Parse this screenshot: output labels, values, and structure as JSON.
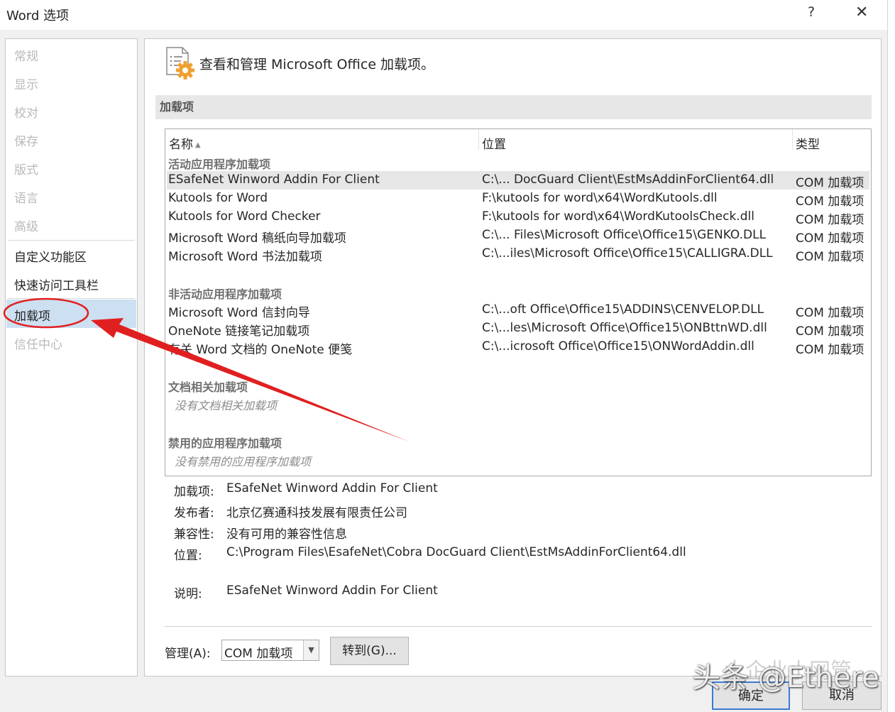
{
  "window": {
    "title": "Word 选项",
    "help": "?",
    "close": "✕"
  },
  "sidebar": {
    "items": [
      {
        "label": "常规",
        "enabled": false
      },
      {
        "label": "显示",
        "enabled": false
      },
      {
        "label": "校对",
        "enabled": false
      },
      {
        "label": "保存",
        "enabled": false
      },
      {
        "label": "版式",
        "enabled": false
      },
      {
        "label": "语言",
        "enabled": false
      },
      {
        "label": "高级",
        "enabled": false
      },
      {
        "label": "自定义功能区",
        "enabled": true
      },
      {
        "label": "快速访问工具栏",
        "enabled": true
      },
      {
        "label": "加载项",
        "enabled": true,
        "selected": true
      },
      {
        "label": "信任中心",
        "enabled": false
      }
    ]
  },
  "main": {
    "header": "查看和管理 Microsoft Office 加载项。",
    "section": "加载项",
    "columns": {
      "name": "名称",
      "location": "位置",
      "type": "类型"
    },
    "groups": {
      "active": "活动应用程序加载项",
      "inactive": "非活动应用程序加载项",
      "document": "文档相关加载项",
      "disabled": "禁用的应用程序加载项"
    },
    "active_rows": [
      {
        "name": "ESafeNet Winword Addin For Client",
        "location": "C:\\... DocGuard Client\\EstMsAddinForClient64.dll",
        "type": "COM 加载项"
      },
      {
        "name": "Kutools for Word",
        "location": "F:\\kutools for word\\x64\\WordKutools.dll",
        "type": "COM 加载项"
      },
      {
        "name": "Kutools for Word Checker",
        "location": "F:\\kutools for word\\x64\\WordKutoolsCheck.dll",
        "type": "COM 加载项"
      },
      {
        "name": "Microsoft Word 稿纸向导加载项",
        "location": "C:\\... Files\\Microsoft Office\\Office15\\GENKO.DLL",
        "type": "COM 加载项"
      },
      {
        "name": "Microsoft Word 书法加载项",
        "location": "C:\\...iles\\Microsoft Office\\Office15\\CALLIGRA.DLL",
        "type": "COM 加载项"
      }
    ],
    "inactive_rows": [
      {
        "name": "Microsoft Word 信封向导",
        "location": "C:\\...oft Office\\Office15\\ADDINS\\CENVELOP.DLL",
        "type": "COM 加载项"
      },
      {
        "name": "OneNote 链接笔记加载项",
        "location": "C:\\...les\\Microsoft Office\\Office15\\ONBttnWD.dll",
        "type": "COM 加载项"
      },
      {
        "name": "有关 Word 文档的 OneNote 便笺",
        "location": "C:\\...icrosoft Office\\Office15\\ONWordAddin.dll",
        "type": "COM 加载项"
      }
    ],
    "no_document": "没有文档相关加载项",
    "no_disabled": "没有禁用的应用程序加载项",
    "details": {
      "addin_label": "加载项:",
      "addin": "ESafeNet Winword Addin For Client",
      "publisher_label": "发布者:",
      "publisher": "北京亿赛通科技发展有限责任公司",
      "compat_label": "兼容性:",
      "compat": "没有可用的兼容性信息",
      "location_label": "位置:",
      "location": "C:\\Program Files\\EsafeNet\\Cobra DocGuard Client\\EstMsAddinForClient64.dll",
      "desc_label": "说明:",
      "desc": "ESafeNet Winword Addin For Client"
    },
    "manage": {
      "label": "管理(A):",
      "value": "COM 加载项",
      "go": "转到(G)..."
    }
  },
  "footer": {
    "ok": "确定",
    "cancel": "取消"
  },
  "watermark": {
    "text": "头条 @Ethere",
    "faint": "大企业小网管"
  },
  "colors": {
    "selected_nav": "#cde0f2",
    "annotation": "#e02020"
  }
}
